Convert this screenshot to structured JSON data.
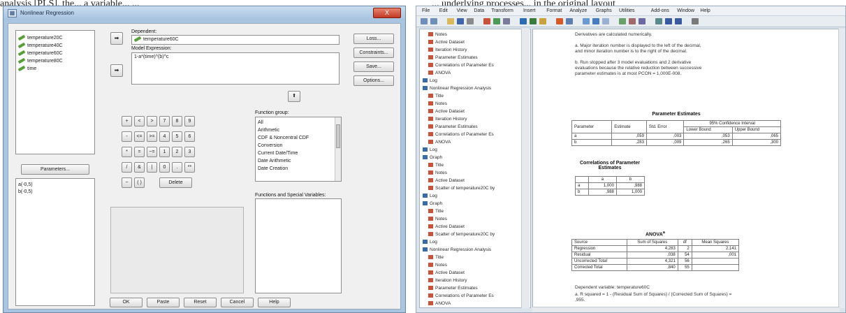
{
  "captions": {
    "left": "analysis [PLS], the... a variable... ...",
    "right": "... underlying processes... in the original layout"
  },
  "dialog": {
    "title": "Nonlinear Regression",
    "close_label": "X",
    "variables": [
      "temperature20C",
      "temperature40C",
      "temperature60C",
      "temperature80C",
      "time"
    ],
    "dependent_label": "Dependent:",
    "dependent_value": "temperature60C",
    "model_label": "Model Expression:",
    "model_value": "1-a*(time)^(b)^c",
    "parameters_button": "Parameters...",
    "parameters": [
      "a(-0,5)",
      "b(-0,5)"
    ],
    "function_group_label": "Function group:",
    "function_groups": [
      "All",
      "Arithmetic",
      "CDF & Noncentral CDF",
      "Conversion",
      "Current Date/Time",
      "Date Arithmetic",
      "Date Creation"
    ],
    "functions_label": "Functions and Special Variables:",
    "keypad": [
      "+",
      "<",
      ">",
      "7",
      "8",
      "9",
      "-",
      "<=",
      ">=",
      "4",
      "5",
      "6",
      "*",
      "=",
      "~=",
      "1",
      "2",
      "3",
      "/",
      "&",
      "|",
      "0",
      ".",
      "**",
      "~",
      "( )"
    ],
    "delete_label": "Delete",
    "side_buttons": [
      "Loss...",
      "Constraints...",
      "Save...",
      "Options..."
    ],
    "bottom_buttons": [
      "OK",
      "Paste",
      "Reset",
      "Cancel",
      "Help"
    ]
  },
  "viewer": {
    "menu": [
      "File",
      "Edit",
      "View",
      "Data",
      "Transform",
      "Insert",
      "Format",
      "Analyze",
      "Graphs",
      "Utilities",
      "Add-ons",
      "Window",
      "Help"
    ],
    "outline": [
      {
        "label": "Notes",
        "level": 1
      },
      {
        "label": "Active Dataset",
        "level": 1
      },
      {
        "label": "Iteration History",
        "level": 1
      },
      {
        "label": "Parameter Estimates",
        "level": 1
      },
      {
        "label": "Correlations of Parameter Es",
        "level": 1
      },
      {
        "label": "ANOVA",
        "level": 1
      },
      {
        "label": "Log",
        "level": 0
      },
      {
        "label": "Nonlinear Regression Analysis",
        "level": 0
      },
      {
        "label": "Title",
        "level": 1
      },
      {
        "label": "Notes",
        "level": 1
      },
      {
        "label": "Active Dataset",
        "level": 1
      },
      {
        "label": "Iteration History",
        "level": 1
      },
      {
        "label": "Parameter Estimates",
        "level": 1
      },
      {
        "label": "Correlations of Parameter Es",
        "level": 1
      },
      {
        "label": "ANOVA",
        "level": 1
      },
      {
        "label": "Log",
        "level": 0
      },
      {
        "label": "Graph",
        "level": 0
      },
      {
        "label": "Title",
        "level": 1
      },
      {
        "label": "Notes",
        "level": 1
      },
      {
        "label": "Active Dataset",
        "level": 1
      },
      {
        "label": "Scatter of temperature20C by",
        "level": 1
      },
      {
        "label": "Log",
        "level": 0
      },
      {
        "label": "Graph",
        "level": 0
      },
      {
        "label": "Title",
        "level": 1
      },
      {
        "label": "Notes",
        "level": 1
      },
      {
        "label": "Active Dataset",
        "level": 1
      },
      {
        "label": "Scatter of temperature20C by",
        "level": 1
      },
      {
        "label": "Log",
        "level": 0
      },
      {
        "label": "Nonlinear Regression Analysis",
        "level": 0
      },
      {
        "label": "Title",
        "level": 1
      },
      {
        "label": "Notes",
        "level": 1
      },
      {
        "label": "Active Dataset",
        "level": 1
      },
      {
        "label": "Iteration History",
        "level": 1
      },
      {
        "label": "Parameter Estimates",
        "level": 1
      },
      {
        "label": "Correlations of Parameter Es",
        "level": 1
      },
      {
        "label": "ANOVA",
        "level": 1
      }
    ],
    "notes": "Derivatives are calculated numerically.\n\na. Major iteration number is displayed to the left of the decimal, and minor iteration number is to the right of the decimal.\n\nb. Run stopped after 3 model evaluations and 2 derivative evaluations because the relative reduction between successive parameter estimates is at most PCON = 1,000E-008.",
    "param_estimates": {
      "title": "Parameter Estimates",
      "ci_header": "95% Confidence Interval",
      "headers": [
        "Parameter",
        "Estimate",
        "Std. Error",
        "Lower Bound",
        "Upper Bound"
      ],
      "rows": [
        [
          "a",
          ",059",
          ",003",
          ",053",
          ",065"
        ],
        [
          "b",
          ",283",
          ",009",
          ",265",
          ",300"
        ]
      ]
    },
    "correlations": {
      "title": "Correlations of Parameter Estimates",
      "headers": [
        "",
        "a",
        "b"
      ],
      "rows": [
        [
          "a",
          "1,000",
          ",988"
        ],
        [
          "b",
          ",988",
          "1,000"
        ]
      ]
    },
    "anova": {
      "title": "ANOVA",
      "headers": [
        "Source",
        "Sum of Squares",
        "df",
        "Mean Squares"
      ],
      "rows": [
        [
          "Regression",
          "4,283",
          "2",
          "2,141"
        ],
        [
          "Residual",
          ",038",
          "54",
          ",001"
        ],
        [
          "Uncorrected Total",
          "4,321",
          "56",
          ""
        ],
        [
          "Corrected Total",
          ",840",
          "55",
          ""
        ]
      ],
      "footnote": "Dependent variable: temperature60C",
      "footnote2": "a. R squared = 1 - (Residual Sum of Squares) / (Corrected Sum of Squares) = ,955."
    }
  }
}
